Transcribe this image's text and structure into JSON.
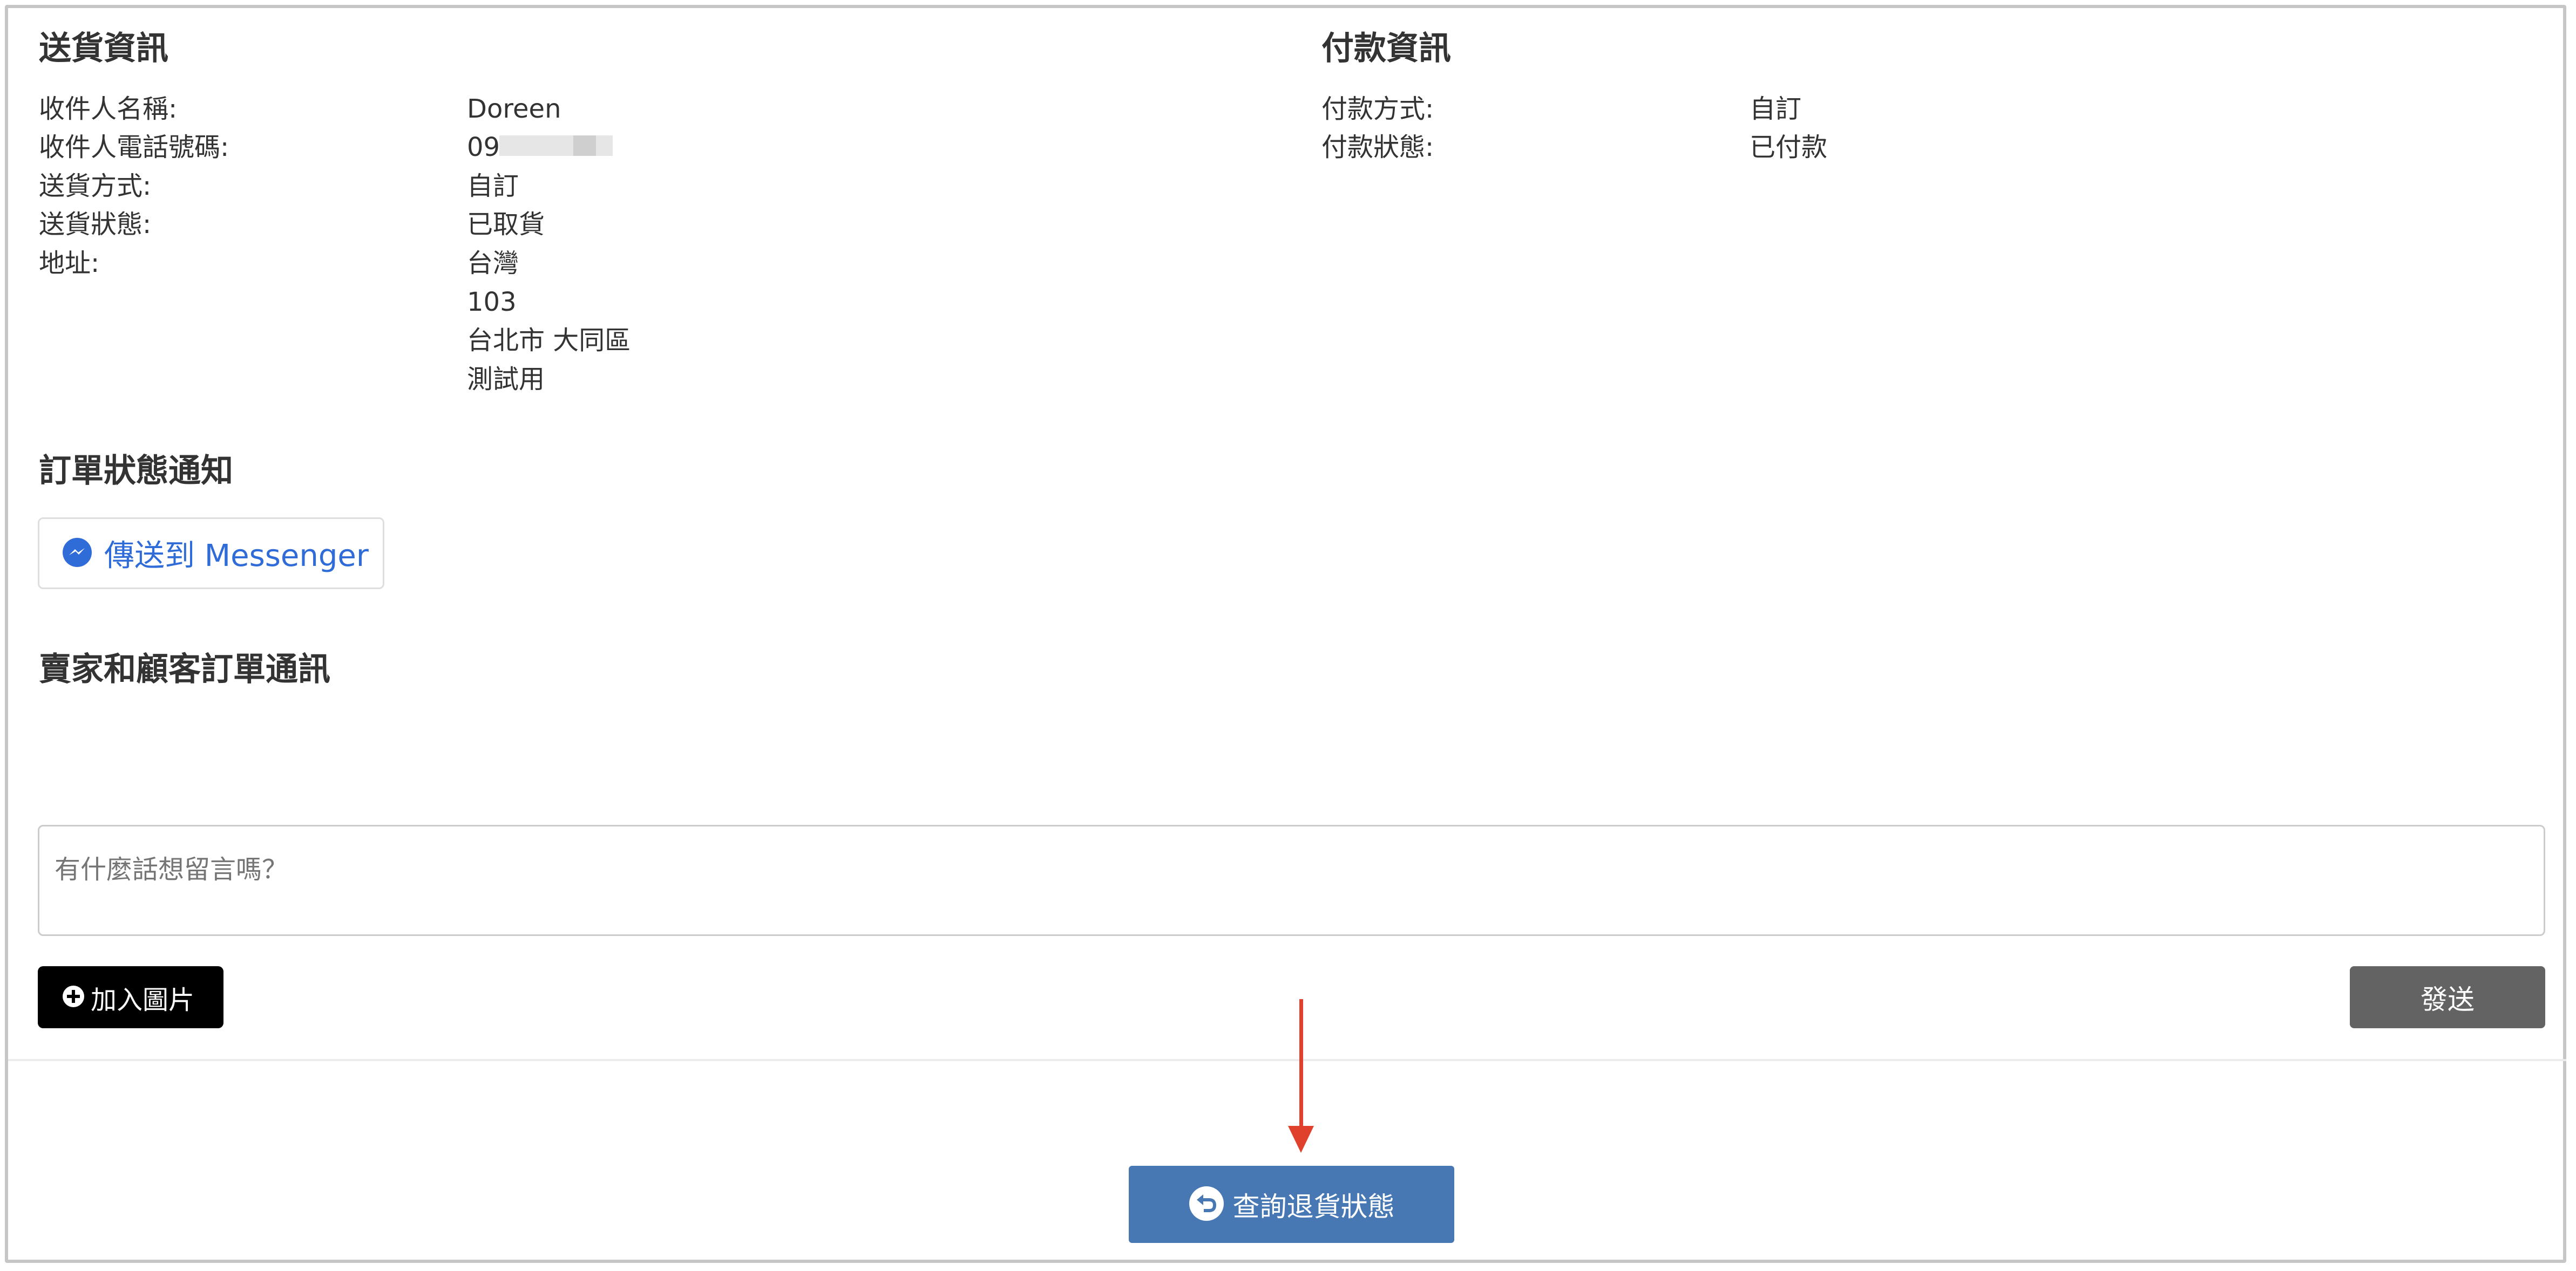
{
  "shipping": {
    "title": "送貨資訊",
    "rows": [
      {
        "label": "收件人名稱:",
        "value": "Doreen"
      },
      {
        "label": "收件人電話號碼:",
        "value": "09"
      },
      {
        "label": "送貨方式:",
        "value": "自訂"
      },
      {
        "label": "送貨狀態:",
        "value": "已取貨"
      },
      {
        "label": "地址:",
        "value": "台灣"
      }
    ],
    "address_lines": [
      "103",
      "台北市 大同區",
      "測試用"
    ]
  },
  "payment": {
    "title": "付款資訊",
    "rows": [
      {
        "label": "付款方式:",
        "value": "自訂"
      },
      {
        "label": "付款狀態:",
        "value": "已付款"
      }
    ]
  },
  "notification": {
    "title": "訂單狀態通知",
    "messenger_button": "傳送到 Messenger"
  },
  "chat": {
    "title": "賣家和顧客訂單通訊",
    "placeholder": "有什麼話想留言嗎？",
    "add_image_button": "加入圖片",
    "send_button": "發送"
  },
  "footer": {
    "return_status_button": "查詢退貨狀態"
  },
  "colors": {
    "messenger_blue": "#2f6cd8",
    "return_button": "#4778b3",
    "send_button": "#636363",
    "annotation_arrow": "#e0412c"
  }
}
